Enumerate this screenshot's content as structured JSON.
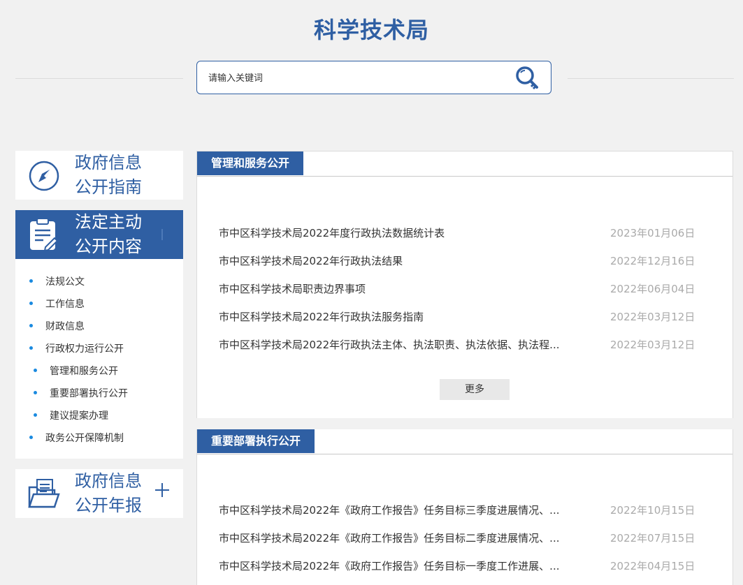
{
  "header": {
    "title": "科学技术局"
  },
  "search": {
    "placeholder": "请输入关键词"
  },
  "sidebar": {
    "cards": [
      {
        "line1": "政府信息",
        "line2": "公开指南"
      },
      {
        "line1": "法定主动",
        "line2": "公开内容"
      },
      {
        "line1": "政府信息",
        "line2": "公开年报"
      }
    ],
    "menu": [
      "法规公文",
      "工作信息",
      "财政信息",
      "行政权力运行公开",
      "管理和服务公开",
      "重要部署执行公开",
      "建议提案办理",
      "政务公开保障机制"
    ]
  },
  "sections": [
    {
      "title": "管理和服务公开",
      "items": [
        {
          "title": "市中区科学技术局2022年度行政执法数据统计表",
          "date": "2023年01月06日"
        },
        {
          "title": "市中区科学技术局2022年行政执法结果",
          "date": "2022年12月16日"
        },
        {
          "title": "市中区科学技术局职责边界事项",
          "date": "2022年06月04日"
        },
        {
          "title": "市中区科学技术局2022年行政执法服务指南",
          "date": "2022年03月12日"
        },
        {
          "title": "市中区科学技术局2022年行政执法主体、执法职责、执法依据、执法程...",
          "date": "2022年03月12日"
        }
      ],
      "more": "更多"
    },
    {
      "title": "重要部署执行公开",
      "items": [
        {
          "title": "市中区科学技术局2022年《政府工作报告》任务目标三季度进展情况、...",
          "date": "2022年10月15日"
        },
        {
          "title": "市中区科学技术局2022年《政府工作报告》任务目标二季度进展情况、...",
          "date": "2022年07月15日"
        },
        {
          "title": "市中区科学技术局2022年《政府工作报告》任务目标一季度工作进展、...",
          "date": "2022年04月15日"
        }
      ]
    }
  ]
}
